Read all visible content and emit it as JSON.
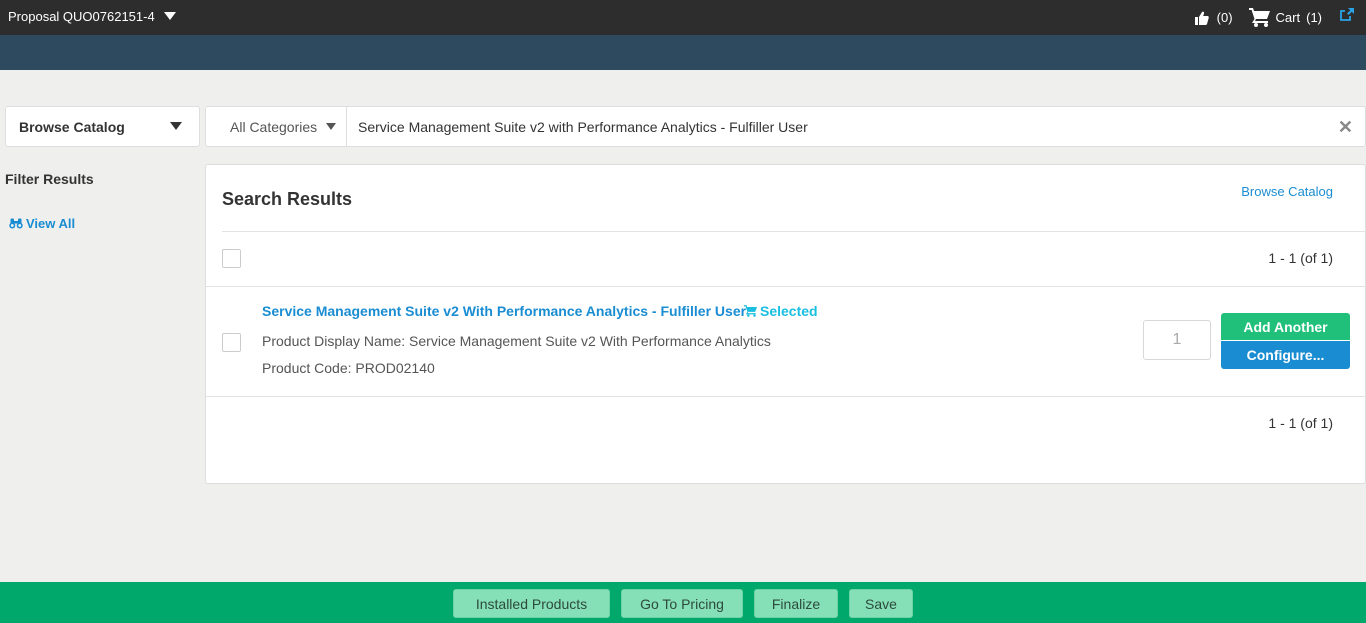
{
  "topbar": {
    "proposal_label": "Proposal QUO0762151-4",
    "likes_count": "(0)",
    "cart_label": "Cart",
    "cart_count": "(1)"
  },
  "browse": {
    "label": "Browse Catalog"
  },
  "search": {
    "category": "All Categories",
    "query": "Service Management Suite v2 with Performance Analytics - Fulfiller User"
  },
  "filter": {
    "title": "Filter Results",
    "view_all": "View All"
  },
  "results": {
    "title": "Search Results",
    "browse_link": "Browse Catalog",
    "count_top": "1 - 1 (of 1)",
    "count_bottom": "1 - 1 (of 1)",
    "items": [
      {
        "name": "Service Management Suite v2 With Performance Analytics - Fulfiller User",
        "status": "Selected",
        "display_name": "Product Display Name: Service Management Suite v2 With Performance Analytics",
        "code": "Product Code: PROD02140",
        "quantity": "1",
        "add_label": "Add Another",
        "configure_label": "Configure..."
      }
    ]
  },
  "footer": {
    "installed": "Installed Products",
    "pricing": "Go To Pricing",
    "finalize": "Finalize",
    "save": "Save"
  },
  "colors": {
    "topbar": "#2d2d2d",
    "banner": "#2e4a5f",
    "link": "#1a8dd2",
    "add_button": "#20c07a",
    "footer": "#00a86b"
  }
}
